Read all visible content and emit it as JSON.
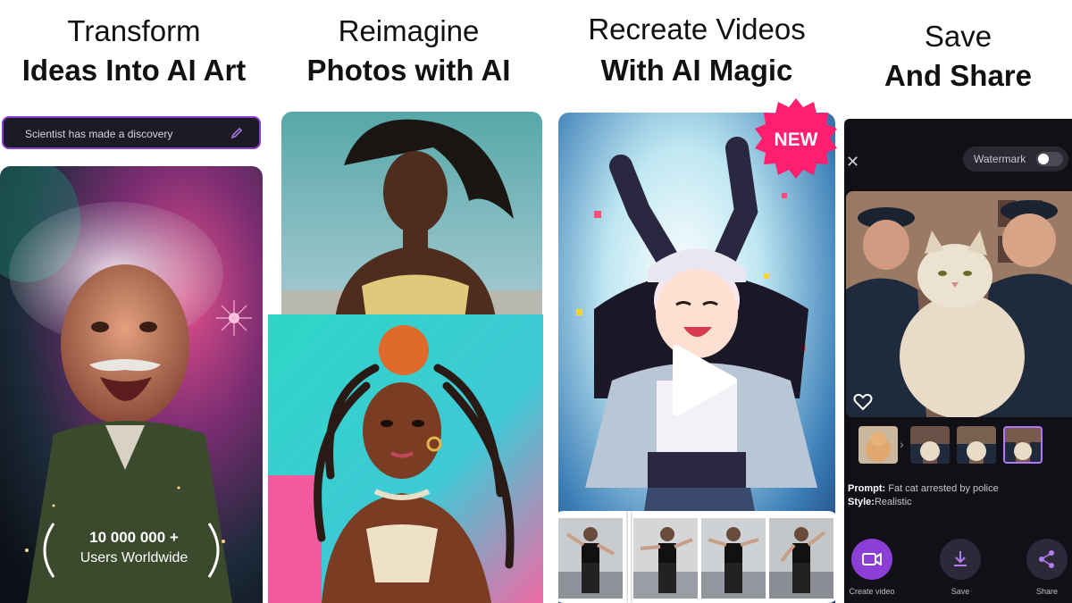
{
  "panel1": {
    "heading_line1": "Transform",
    "heading_line2": "Ideas Into AI Art",
    "prompt_text": "Scientist has made a discovery",
    "users_count": "10 000 000 +",
    "users_label": "Users Worldwide"
  },
  "panel2": {
    "heading_line1": "Reimagine",
    "heading_line2": "Photos with AI"
  },
  "panel3": {
    "heading_line1": "Recreate Videos",
    "heading_line2": "With AI Magic",
    "badge": "NEW"
  },
  "panel4": {
    "heading_line1": "Save",
    "heading_line2": "And Share",
    "watermark_label": "Watermark",
    "watermark_on": false,
    "prompt_label": "Prompt:",
    "prompt_value": "Fat cat arrested by police",
    "style_label": "Style:",
    "style_value": "Realistic",
    "actions": {
      "create_video": "Create video",
      "save": "Save",
      "share": "Share"
    }
  },
  "colors": {
    "accent_purple": "#8b3fd6",
    "badge_pink": "#ff1f6e",
    "dark_bg": "#111016"
  }
}
